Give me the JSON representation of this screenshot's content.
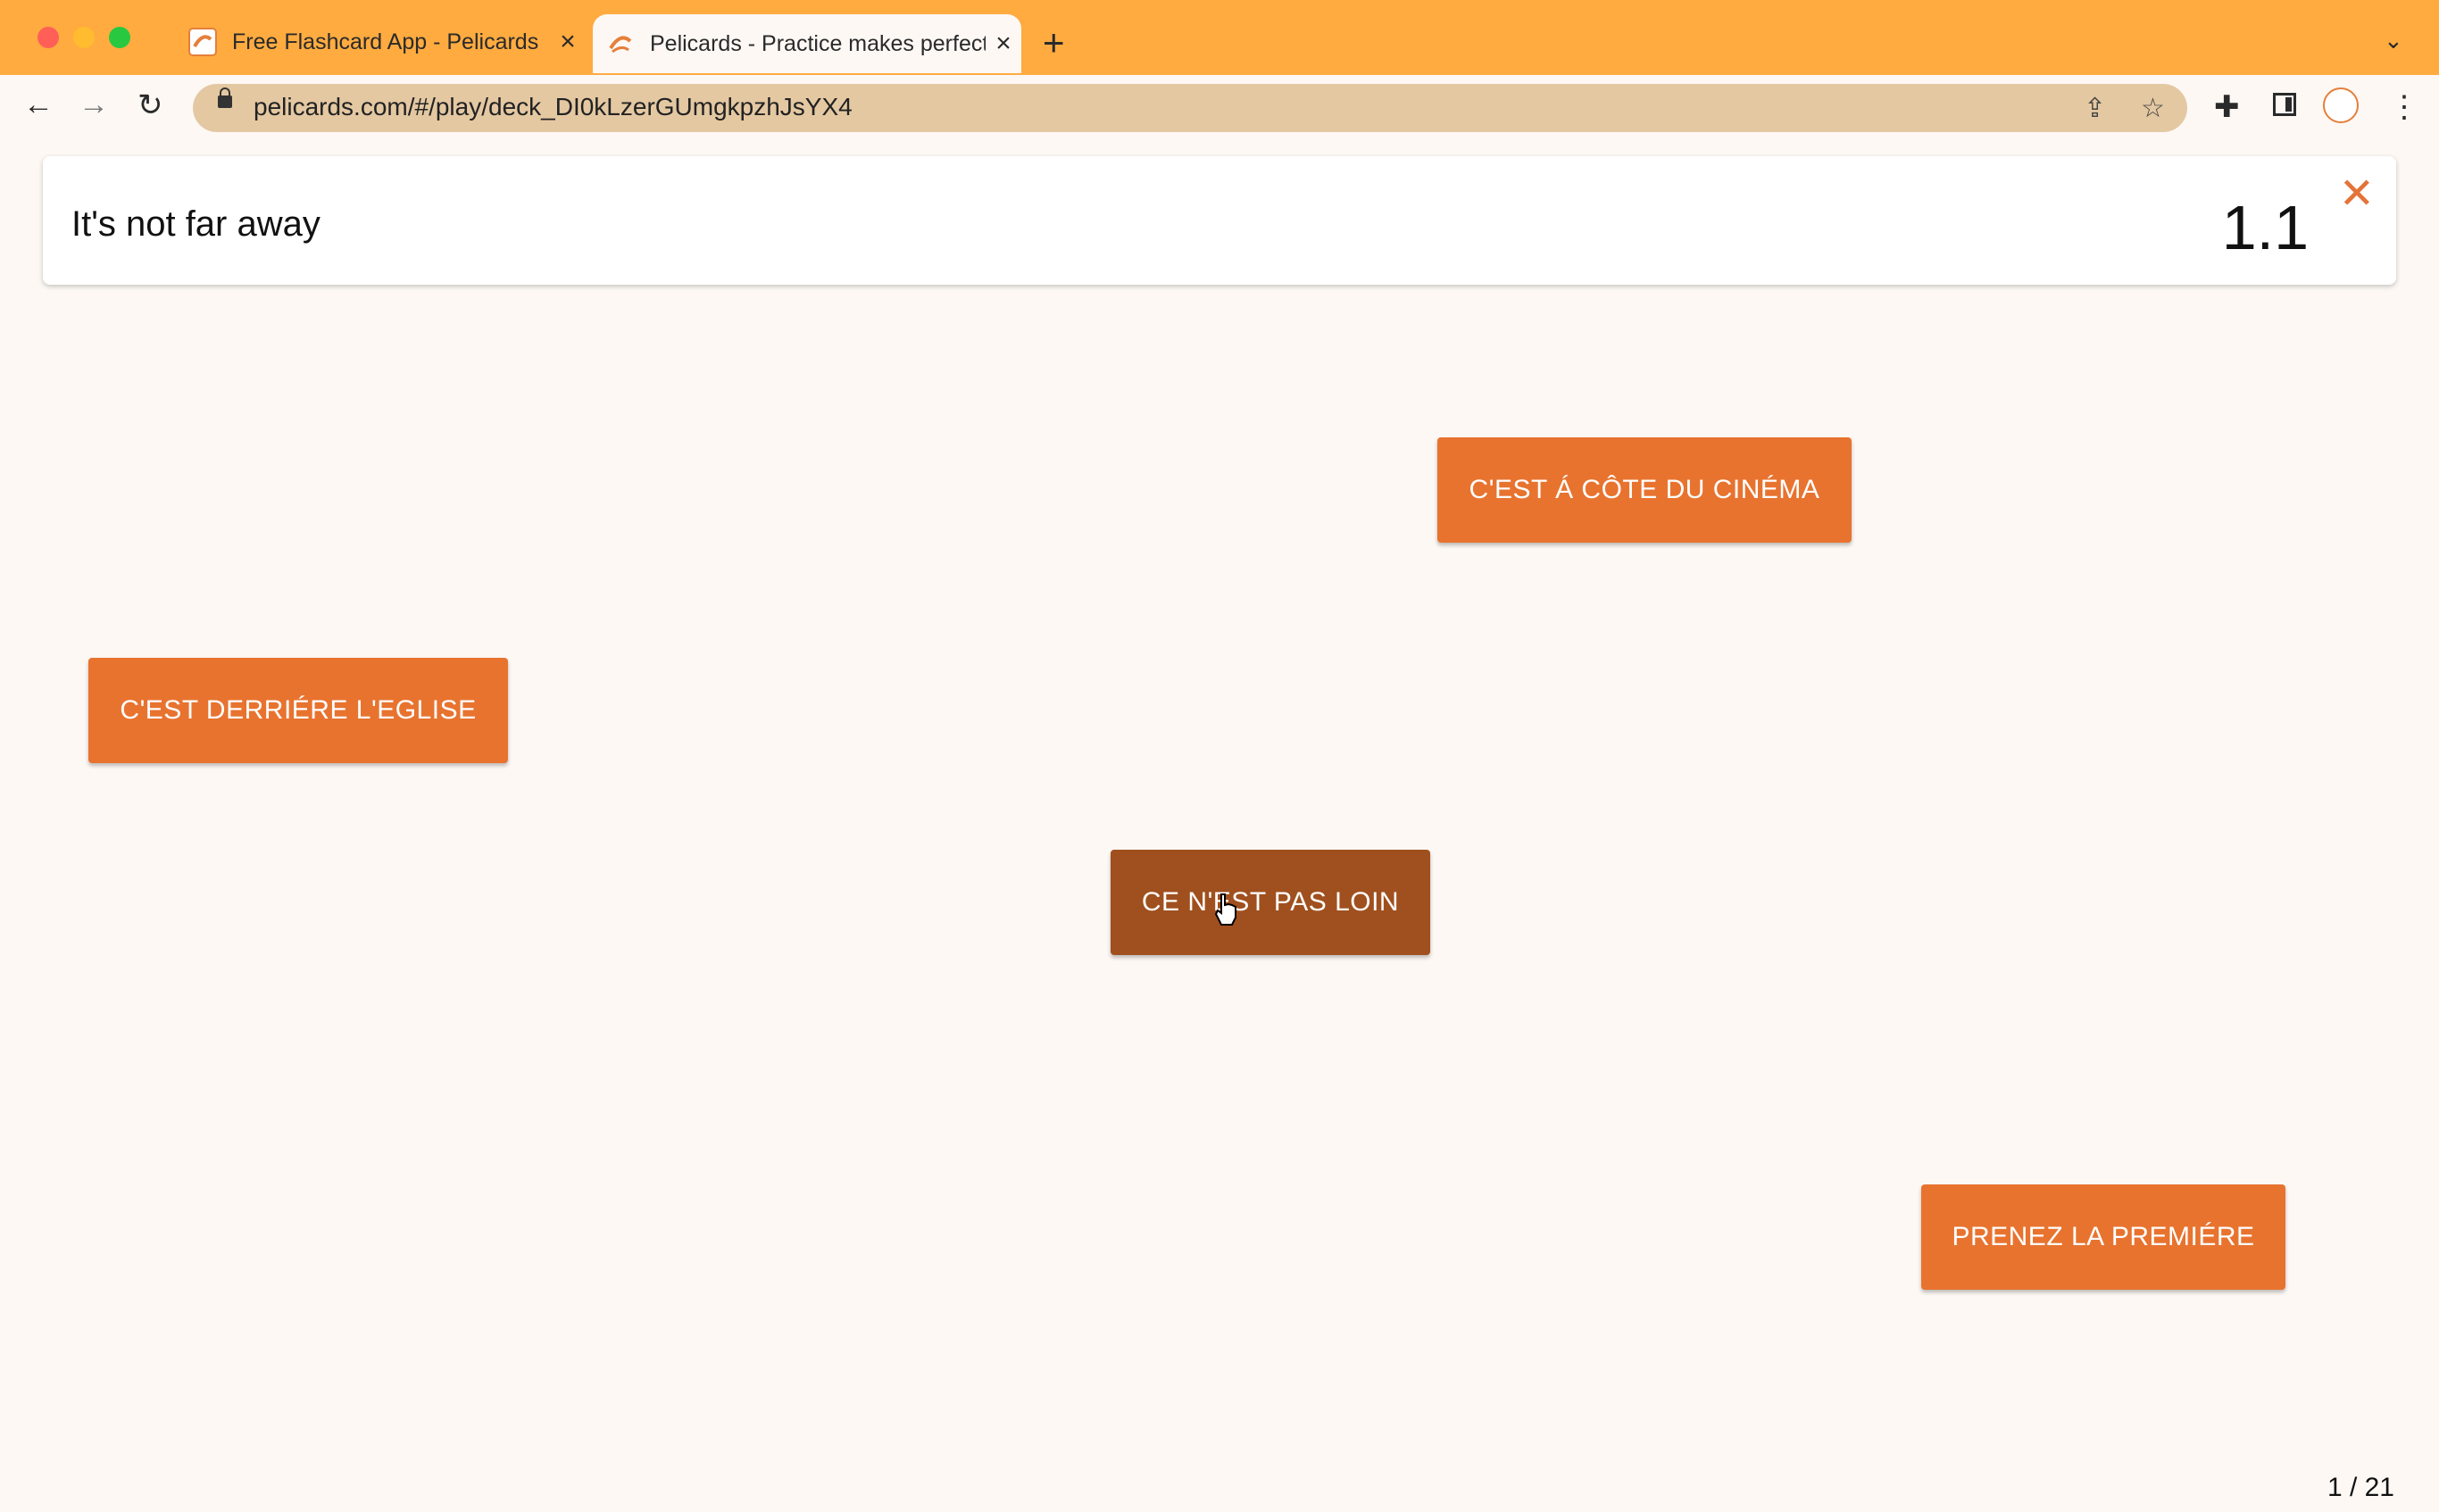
{
  "browser": {
    "tabs": [
      {
        "title": "Free Flashcard App - Pelicards",
        "icon": "pelicards-favicon"
      },
      {
        "title": "Pelicards - Practice makes perfect",
        "icon": "pelicards-favicon",
        "active": true
      }
    ],
    "url": "pelicards.com/#/play/deck_DI0kLzerGUmgkpzhJsYX4"
  },
  "question": {
    "prompt": "It's not far away",
    "level": "1.1"
  },
  "answers": [
    {
      "label": "C'EST Á CÔTE DU CINÉMA"
    },
    {
      "label": "C'EST DERRIÉRE L'EGLISE"
    },
    {
      "label": "CE N'EST PAS LOIN",
      "state": "hovered"
    },
    {
      "label": "PRENEZ LA PREMIÉRE"
    }
  ],
  "progress": "1 / 21",
  "colors": {
    "accent": "#e8732f",
    "accent_hover": "#a0501e",
    "chrome": "#ffab40"
  }
}
